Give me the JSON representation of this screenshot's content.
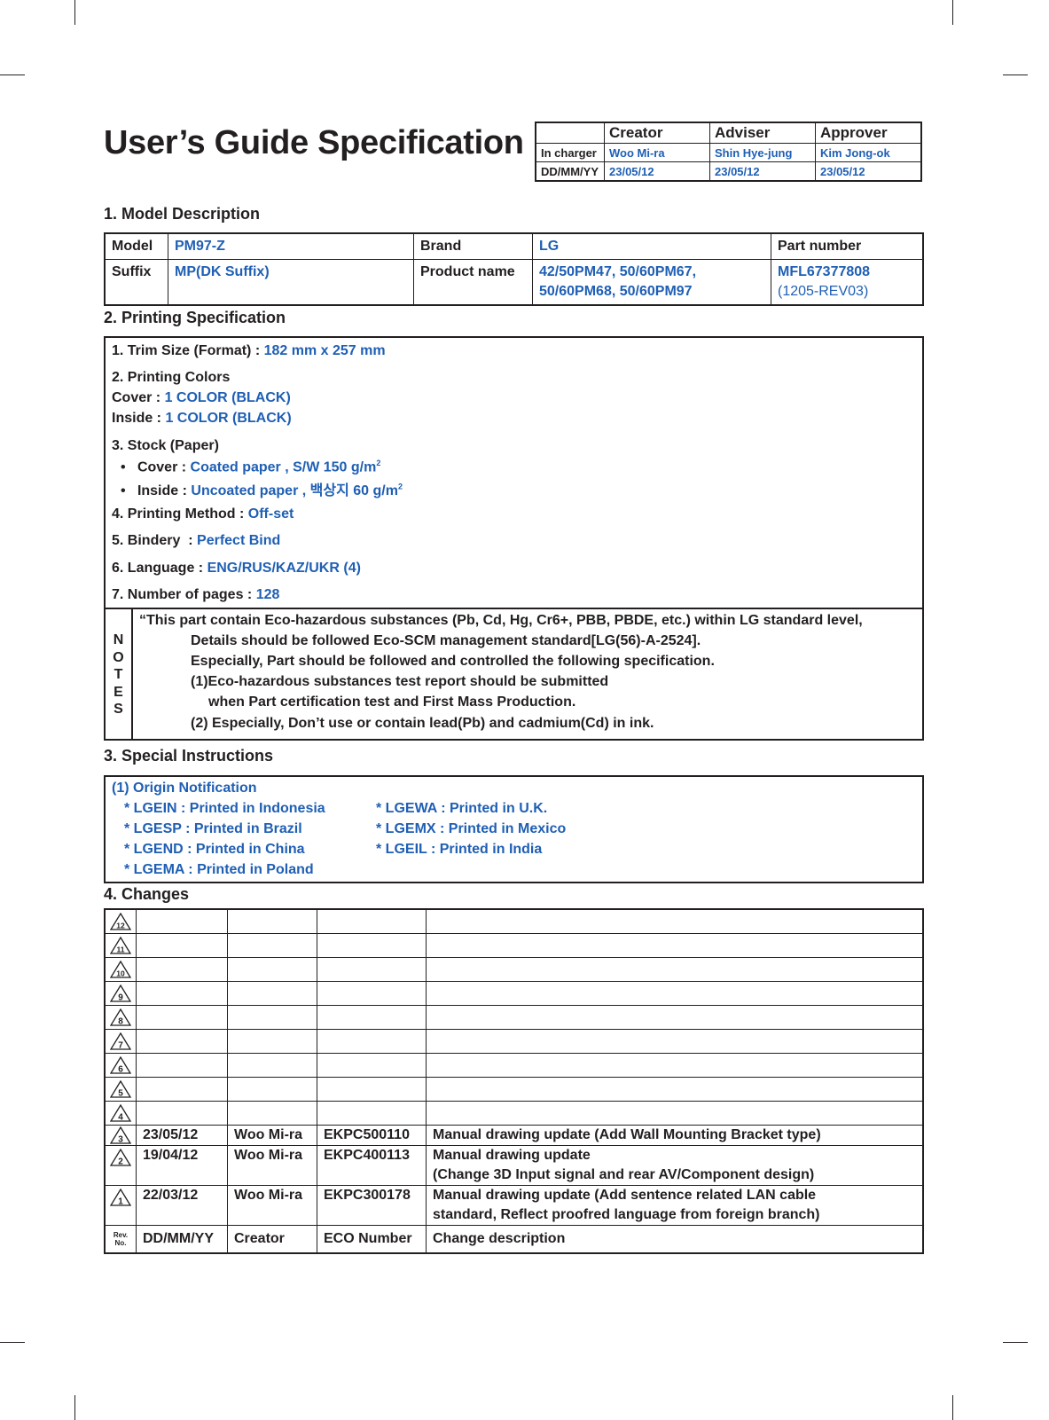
{
  "title": "User’s Guide Specification",
  "approval": {
    "headers": [
      "",
      "Creator",
      "Adviser",
      "Approver"
    ],
    "rows": [
      {
        "label": "In charger",
        "values": [
          "Woo Mi-ra",
          "Shin Hye-jung",
          "Kim Jong-ok"
        ]
      },
      {
        "label": "DD/MM/YY",
        "values": [
          "23/05/12",
          "23/05/12",
          "23/05/12"
        ]
      }
    ]
  },
  "model_description": {
    "heading": "1. Model Description",
    "model_label": "Model",
    "model_value": "PM97-Z",
    "brand_label": "Brand",
    "brand_value": "LG",
    "part_number_label": "Part number",
    "suffix_label": "Suffix",
    "suffix_value": "MP(DK Suffix)",
    "product_name_label": "Product name",
    "product_name_line1": "42/50PM47, 50/60PM67,",
    "product_name_line2": "50/60PM68, 50/60PM97",
    "part_number_value": "MFL67377808",
    "part_number_rev": "(1205-REV03)"
  },
  "printing_spec": {
    "heading": "2. Printing Specification",
    "trim_label": "1. Trim Size (Format) : ",
    "trim_value": "182 mm x 257 mm",
    "colors_label": "2. Printing Colors",
    "cover_color_label": " Cover : ",
    "cover_color_value": "1 COLOR (BLACK)",
    "inside_color_label": " Inside : ",
    "inside_color_value": "1 COLOR (BLACK)",
    "stock_label": "3. Stock (Paper)",
    "stock_cover_label": "Cover : ",
    "stock_cover_value": "Coated paper , S/W 150 g/m",
    "stock_cover_sup": "2",
    "stock_inside_label": "Inside : ",
    "stock_inside_value": "Uncoated paper , 백상지 60 g/m",
    "stock_inside_sup": "2",
    "method_label": "4. Printing Method : ",
    "method_value": "Off-set",
    "bindery_label": "5. Bindery  : ",
    "bindery_value": "Perfect Bind",
    "language_label": "6. Language : ",
    "language_value": "ENG/RUS/KAZ/UKR (4)",
    "pages_label": "7. Number of pages : ",
    "pages_value": "128",
    "notes_label": [
      "N",
      "O",
      "T",
      "E",
      "S"
    ],
    "notes_lines": [
      "“This part contain Eco-hazardous substances (Pb, Cd, Hg, Cr6+, PBB, PBDE, etc.) within LG standard level,",
      "Details should be followed Eco-SCM management standard[LG(56)-A-2524].",
      "Especially, Part should be followed and controlled the following specification.",
      "(1)Eco-hazardous substances test report should be submitted",
      "when  Part certification test and First Mass Production.",
      "(2) Especially, Don’t use or contain lead(Pb) and cadmium(Cd) in ink."
    ]
  },
  "special_instructions": {
    "heading": "3. Special Instructions",
    "subheading": "(1) Origin Notification",
    "left": [
      "* LGEIN : Printed in Indonesia",
      "* LGESP : Printed in Brazil",
      "* LGEND : Printed in China",
      "* LGEMA : Printed in Poland"
    ],
    "right": [
      "* LGEWA : Printed in U.K.",
      "* LGEMX : Printed in Mexico",
      "* LGEIL : Printed in India"
    ]
  },
  "changes": {
    "heading": "4. Changes",
    "empty_revs": [
      "12",
      "11",
      "10",
      "9",
      "8",
      "7",
      "6",
      "5",
      "4"
    ],
    "rows": [
      {
        "rev": "3",
        "date": "23/05/12",
        "creator": "Woo Mi-ra",
        "eco": "EKPC500110",
        "desc1": "Manual drawing update (Add Wall Mounting Bracket type)",
        "desc2": ""
      },
      {
        "rev": "2",
        "date": "19/04/12",
        "creator": "Woo Mi-ra",
        "eco": "EKPC400113",
        "desc1": "Manual drawing update",
        "desc2": "(Change 3D Input signal and rear AV/Component design)"
      },
      {
        "rev": "1",
        "date": "22/03/12",
        "creator": "Woo Mi-ra",
        "eco": "EKPC300178",
        "desc1": "Manual drawing update (Add sentence related LAN cable",
        "desc2": "standard, Reflect proofred language from foreign branch)"
      }
    ],
    "footer": {
      "rev_line1": "Rev.",
      "rev_line2": "No.",
      "date": "DD/MM/YY",
      "creator": "Creator",
      "eco": "ECO Number",
      "desc": "Change description"
    }
  }
}
